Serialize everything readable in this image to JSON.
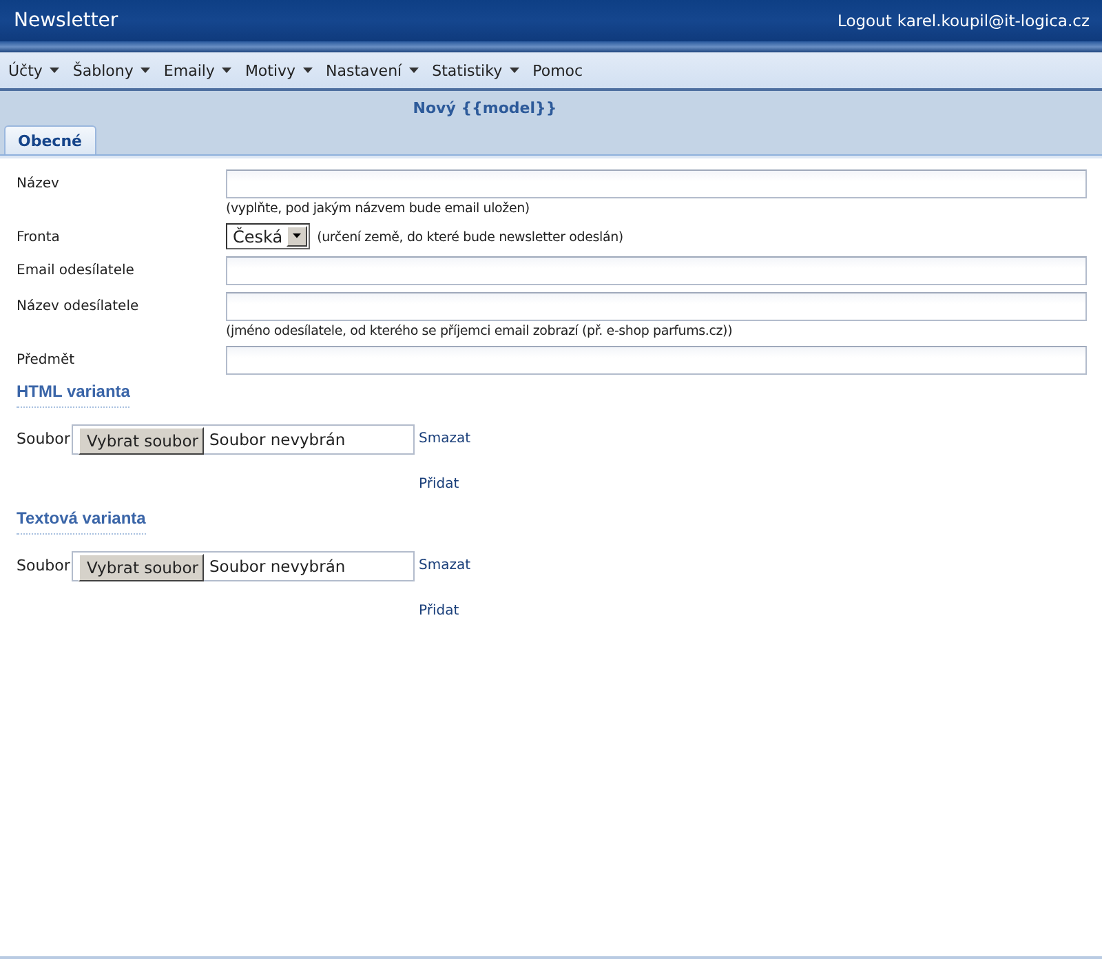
{
  "header": {
    "title": "Newsletter",
    "logout": "Logout",
    "user": "karel.koupil@it-logica.cz"
  },
  "menu": [
    {
      "label": "Účty",
      "dropdown": true
    },
    {
      "label": "Šablony",
      "dropdown": true
    },
    {
      "label": "Emaily",
      "dropdown": true
    },
    {
      "label": "Motivy",
      "dropdown": true
    },
    {
      "label": "Nastavení",
      "dropdown": true
    },
    {
      "label": "Statistiky",
      "dropdown": true
    },
    {
      "label": "Pomoc",
      "dropdown": false
    }
  ],
  "page_title": "Nový {{model}}",
  "tabs": [
    {
      "label": "Obecné",
      "selected": true
    }
  ],
  "form": [
    {
      "kind": "text",
      "label": "Název",
      "hint": "(vyplňte, pod jakým názvem bude email uložen)"
    },
    {
      "kind": "select",
      "label": "Fronta",
      "value": "Česká",
      "hint": "(určení země, do které bude newsletter odeslán)"
    },
    {
      "kind": "text",
      "label": "Email odesílatele"
    },
    {
      "kind": "text",
      "label": "Název odesílatele",
      "hint": "(jméno odesílatele, od kterého se příjemci email zobrazí (př. e-shop parfums.cz))"
    },
    {
      "kind": "text",
      "label": "Předmět"
    }
  ],
  "sections": [
    {
      "heading": "HTML varianta",
      "file_label": "Soubor",
      "choose": "Vybrat soubor",
      "status": "Soubor nevybrán",
      "delete": "Smazat",
      "add": "Přidat"
    },
    {
      "heading": "Textová varianta",
      "file_label": "Soubor",
      "choose": "Vybrat soubor",
      "status": "Soubor nevybrán",
      "delete": "Smazat",
      "add": "Přidat"
    }
  ]
}
